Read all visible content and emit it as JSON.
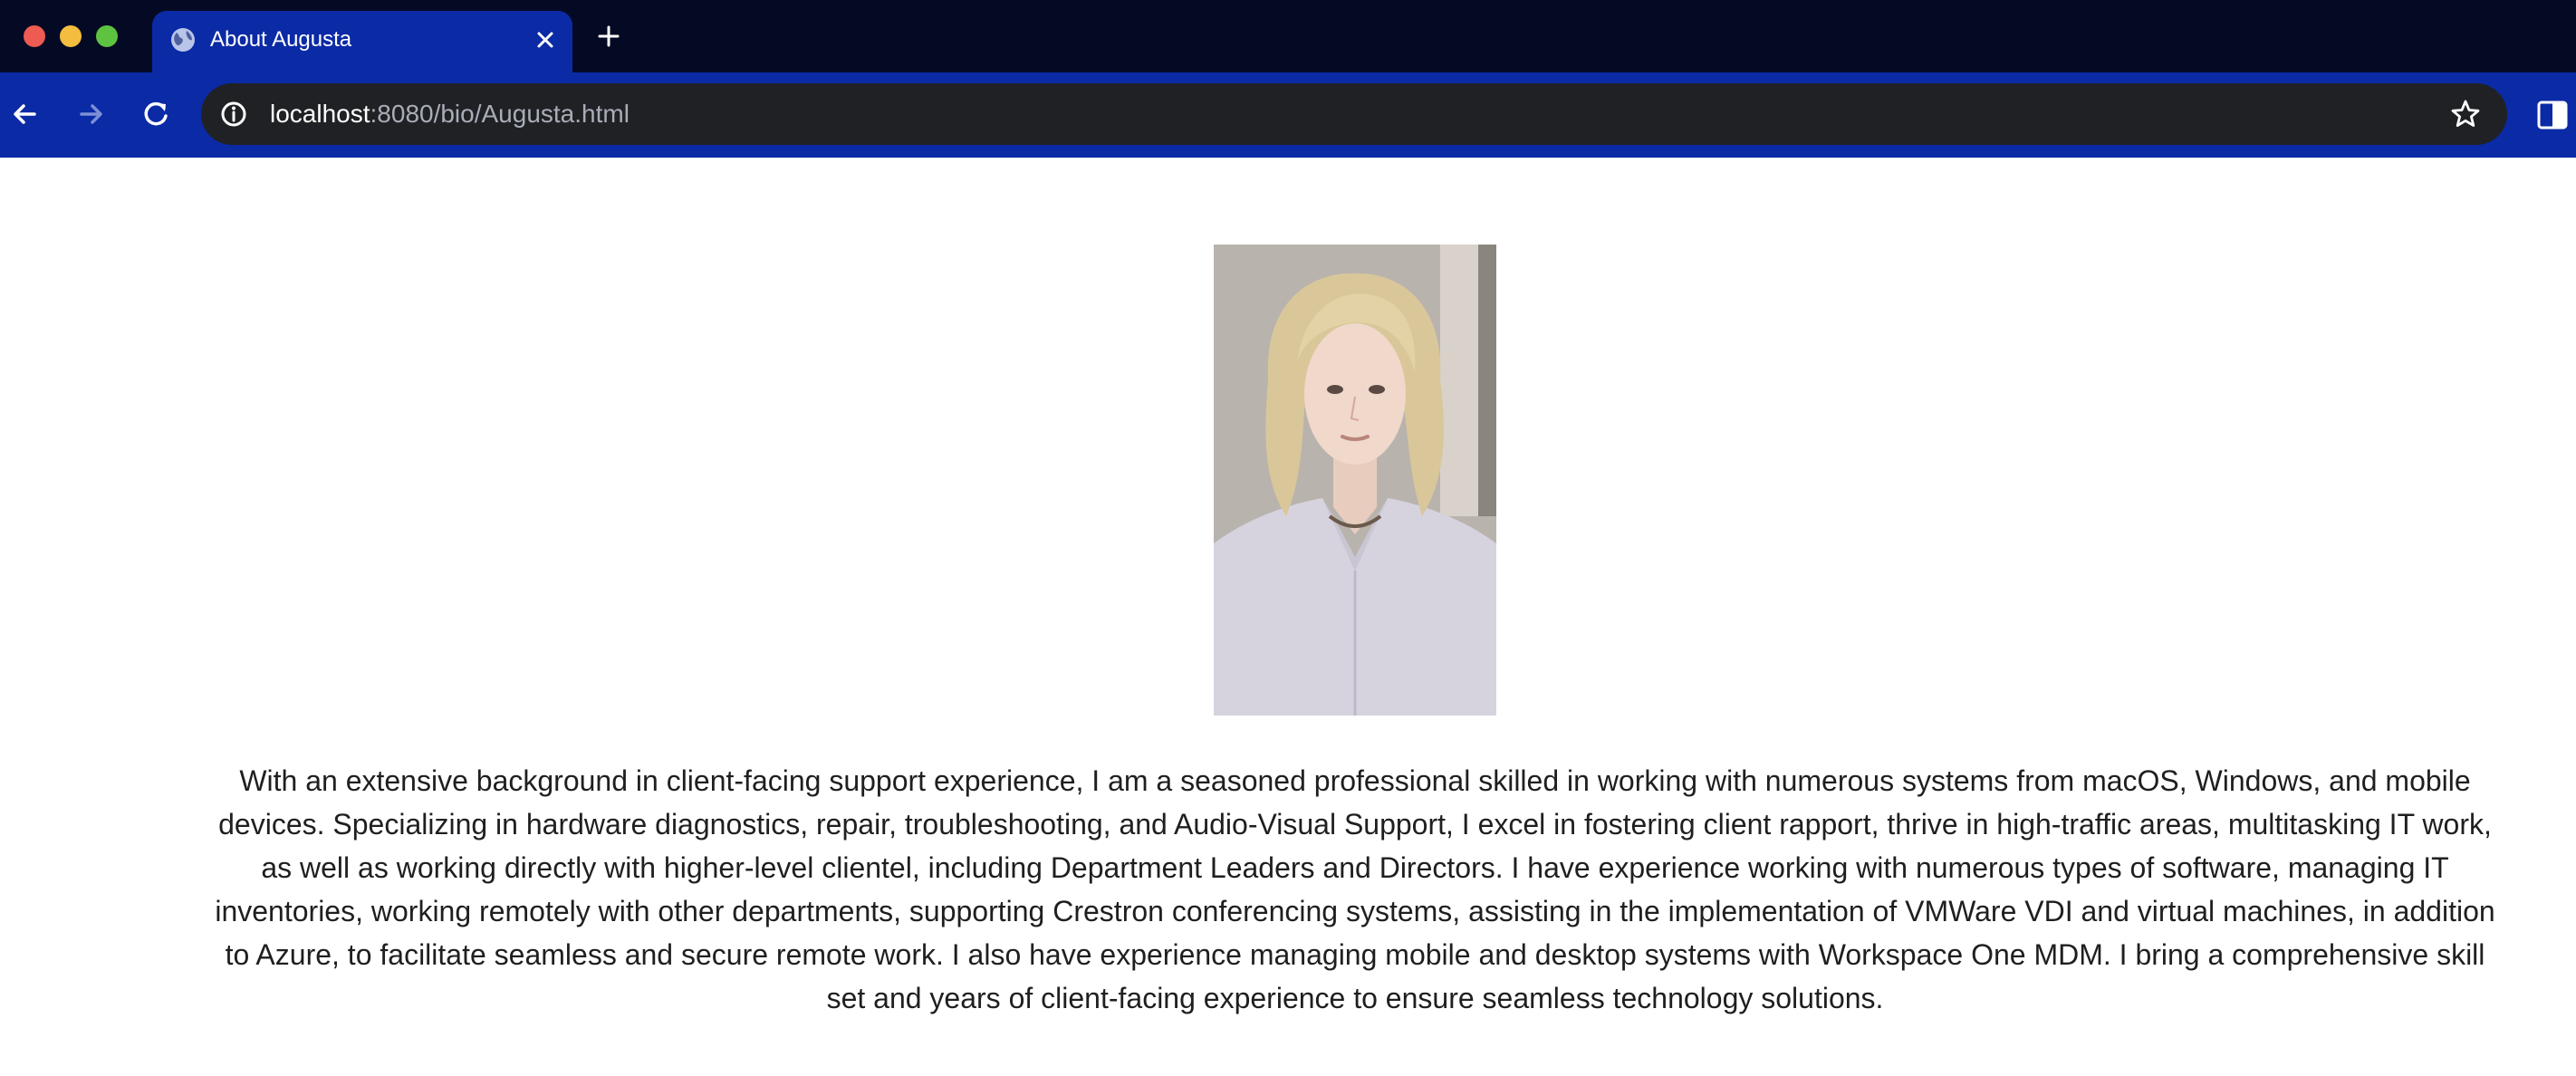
{
  "browser": {
    "tab_title": "About Augusta",
    "url_host": "localhost",
    "url_path": ":8080/bio/Augusta.html"
  },
  "page": {
    "bio": "With an extensive background in client-facing support experience, I am a seasoned professional skilled in working with numerous systems from macOS, Windows, and mobile devices. Specializing in hardware diagnostics, repair, troubleshooting, and Audio-Visual Support, I excel in fostering client rapport, thrive in high-traffic areas, multitasking IT work, as well as working directly with higher-level clientel, including Department Leaders and Directors. I have experience working with numerous types of software, managing IT inventories, working remotely with other departments, supporting Crestron conferencing systems, assisting in the implementation of VMWare VDI and virtual machines, in addition to Azure, to facilitate seamless and secure remote work. I also have experience managing mobile and desktop systems with Workspace One MDM. I bring a comprehensive skill set and years of client-facing experience to ensure seamless technology solutions."
  },
  "icons": {
    "traffic_lights": [
      "close-window",
      "minimize-window",
      "maximize-window"
    ],
    "tab": "globe-icon",
    "toolbar": [
      "back-arrow-icon",
      "forward-arrow-icon",
      "reload-icon",
      "info-icon",
      "star-icon",
      "side-panel-icon"
    ]
  },
  "colors": {
    "tabbar_bg": "#050a24",
    "toolbar_bg": "#0b2aa6",
    "omnibox_bg": "#202124",
    "text": "#1f1f1f"
  }
}
